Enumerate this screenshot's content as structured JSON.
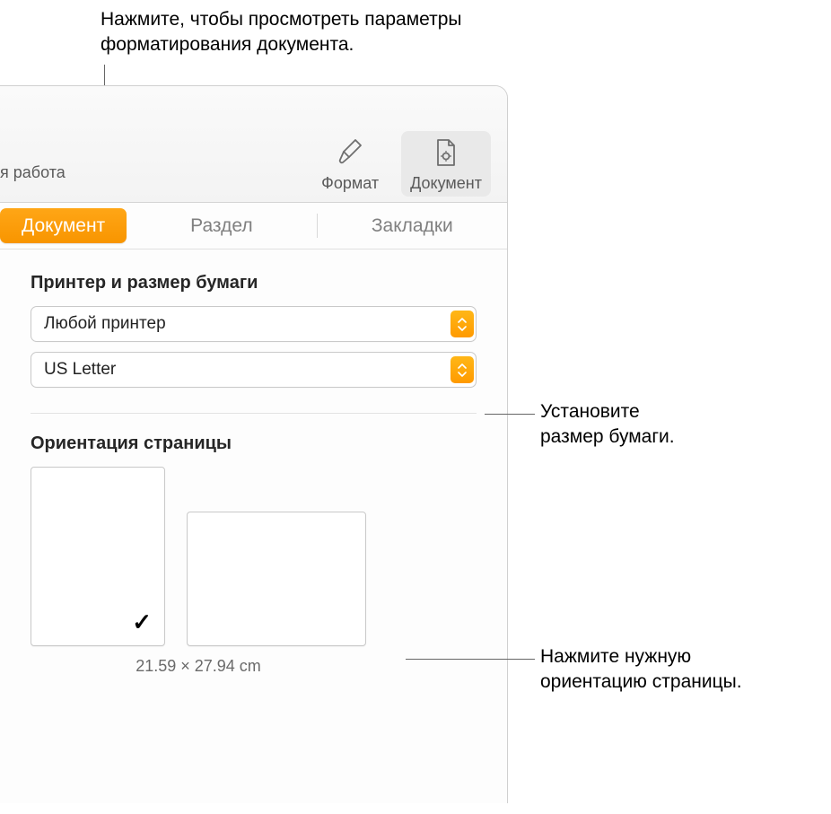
{
  "callouts": {
    "top": "Нажмите, чтобы просмотреть параметры\nформатирования документа.",
    "paper": "Установите\nразмер бумаги.",
    "orient": "Нажмите нужную\nориентацию страницы."
  },
  "toolbar": {
    "left_truncated": "я работа",
    "format_label": "Формат",
    "document_label": "Документ"
  },
  "tabs": {
    "document": "Документ",
    "section": "Раздел",
    "bookmarks": "Закладки"
  },
  "printer_section": {
    "title": "Принтер и размер бумаги",
    "printer_value": "Любой принтер",
    "paper_value": "US Letter"
  },
  "orientation_section": {
    "title": "Ориентация страницы",
    "dimensions": "21.59 × 27.94 cm"
  }
}
